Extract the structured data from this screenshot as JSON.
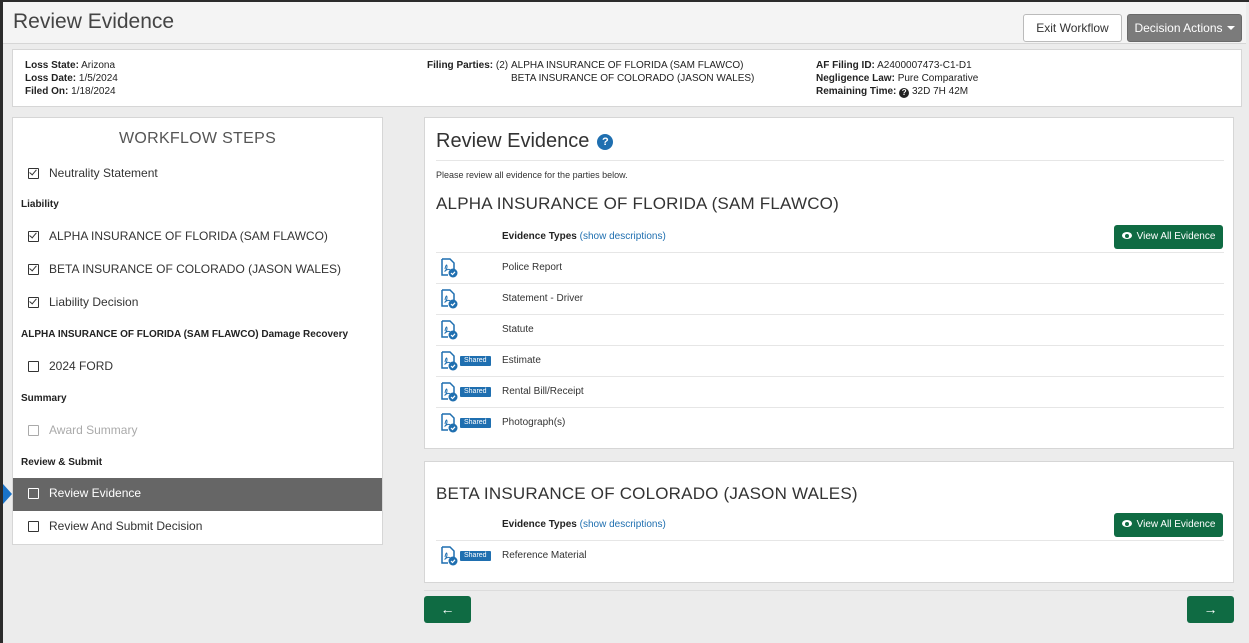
{
  "header": {
    "title": "Review Evidence",
    "exit_label": "Exit Workflow",
    "decision_label": "Decision Actions"
  },
  "info": {
    "loss_state_label": "Loss State:",
    "loss_state": "Arizona",
    "loss_date_label": "Loss Date:",
    "loss_date": "1/5/2024",
    "filed_on_label": "Filed On:",
    "filed_on": "1/18/2024",
    "filing_parties_label": "Filing Parties:",
    "filing_parties_count": "(2)",
    "filing_parties": [
      "ALPHA INSURANCE OF FLORIDA (SAM FLAWCO)",
      "BETA INSURANCE OF COLORADO (JASON WALES)"
    ],
    "af_filing_id_label": "AF Filing ID:",
    "af_filing_id": "A2400007473-C1-D1",
    "negligence_law_label": "Negligence Law:",
    "negligence_law": "Pure Comparative",
    "remaining_time_label": "Remaining Time:",
    "remaining_time": "32D 7H 42M"
  },
  "workflow": {
    "title": "WORKFLOW STEPS",
    "neutrality": "Neutrality Statement",
    "section_liability": "Liability",
    "liability_items": [
      "ALPHA INSURANCE OF FLORIDA (SAM FLAWCO)",
      "BETA INSURANCE OF COLORADO (JASON WALES)",
      "Liability Decision"
    ],
    "section_damage": "ALPHA INSURANCE OF FLORIDA (SAM FLAWCO) Damage Recovery",
    "damage_item": "2024 FORD",
    "section_summary": "Summary",
    "summary_item": "Award Summary",
    "section_review": "Review & Submit",
    "review_items": [
      "Review Evidence",
      "Review And Submit Decision"
    ]
  },
  "main": {
    "title": "Review Evidence",
    "help_glyph": "?",
    "instructions": "Please review all evidence for the parties below.",
    "evidence_types_label": "Evidence Types",
    "show_descriptions": "(show descriptions)",
    "view_all_label": "View All Evidence",
    "shared_label": "Shared",
    "party1": {
      "name": "ALPHA INSURANCE OF FLORIDA (SAM FLAWCO)",
      "evidence": [
        "Police Report",
        "Statement - Driver",
        "Statute",
        "Estimate",
        "Rental Bill/Receipt",
        "Photograph(s)"
      ]
    },
    "party2": {
      "name": "BETA INSURANCE OF COLORADO (JASON WALES)",
      "evidence": [
        "Reference Material"
      ]
    }
  },
  "nav": {
    "prev_glyph": "←",
    "next_glyph": "→"
  },
  "colors": {
    "primary_green": "#0f6b43",
    "link_blue": "#1f6fb0",
    "active_step": "#666666"
  }
}
